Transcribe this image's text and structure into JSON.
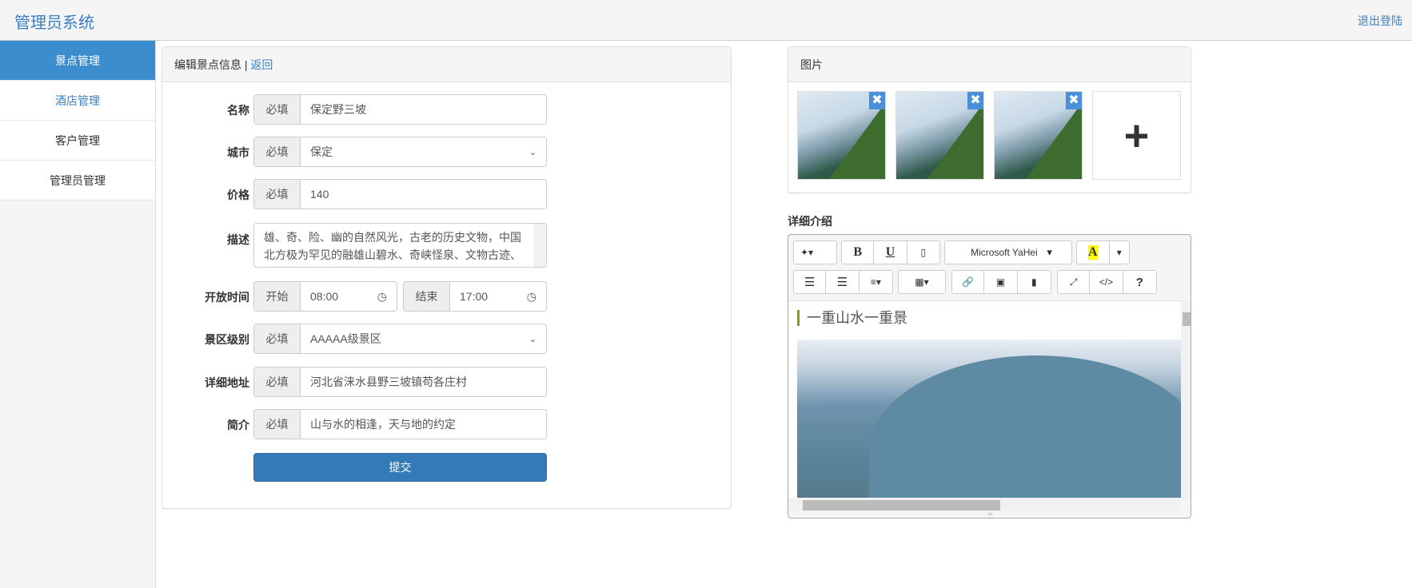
{
  "header": {
    "title": "管理员系统",
    "logout": "退出登陆"
  },
  "sidebar": {
    "items": [
      {
        "label": "景点管理"
      },
      {
        "label": "酒店管理"
      },
      {
        "label": "客户管理"
      },
      {
        "label": "管理员管理"
      }
    ]
  },
  "form": {
    "title": "编辑景点信息",
    "sep": "|",
    "back": "返回",
    "required": "必填",
    "name": {
      "label": "名称",
      "value": "保定野三坡"
    },
    "city": {
      "label": "城市",
      "value": "保定"
    },
    "price": {
      "label": "价格",
      "value": "140"
    },
    "desc": {
      "label": "描述",
      "value": "雄、奇、险、幽的自然风光，古老的历史文物，中国北方极为罕见的融雄山碧水、奇峡怪泉、文物古迹、名树古寺于一身的风景名胜"
    },
    "hours": {
      "label": "开放时间",
      "start_label": "开始",
      "start": "08:00",
      "end_label": "结束",
      "end": "17:00"
    },
    "level": {
      "label": "景区级别",
      "value": "AAAAA级景区"
    },
    "address": {
      "label": "详细地址",
      "value": "河北省涞水县野三坡镇苟各庄村"
    },
    "intro": {
      "label": "简介",
      "value": "山与水的相逢，天与地的约定"
    },
    "submit": "提交"
  },
  "images": {
    "title": "图片",
    "add": "+",
    "delete": "✖"
  },
  "editor": {
    "title": "详细介绍",
    "font": "Microsoft YaHei",
    "heading": "一重山水一重景",
    "tools": {
      "bold": "B",
      "underline": "U",
      "color": "A",
      "code": "</>",
      "help": "?"
    }
  },
  "colors": {
    "accent": "#3c8dce",
    "button": "#337ab7"
  }
}
